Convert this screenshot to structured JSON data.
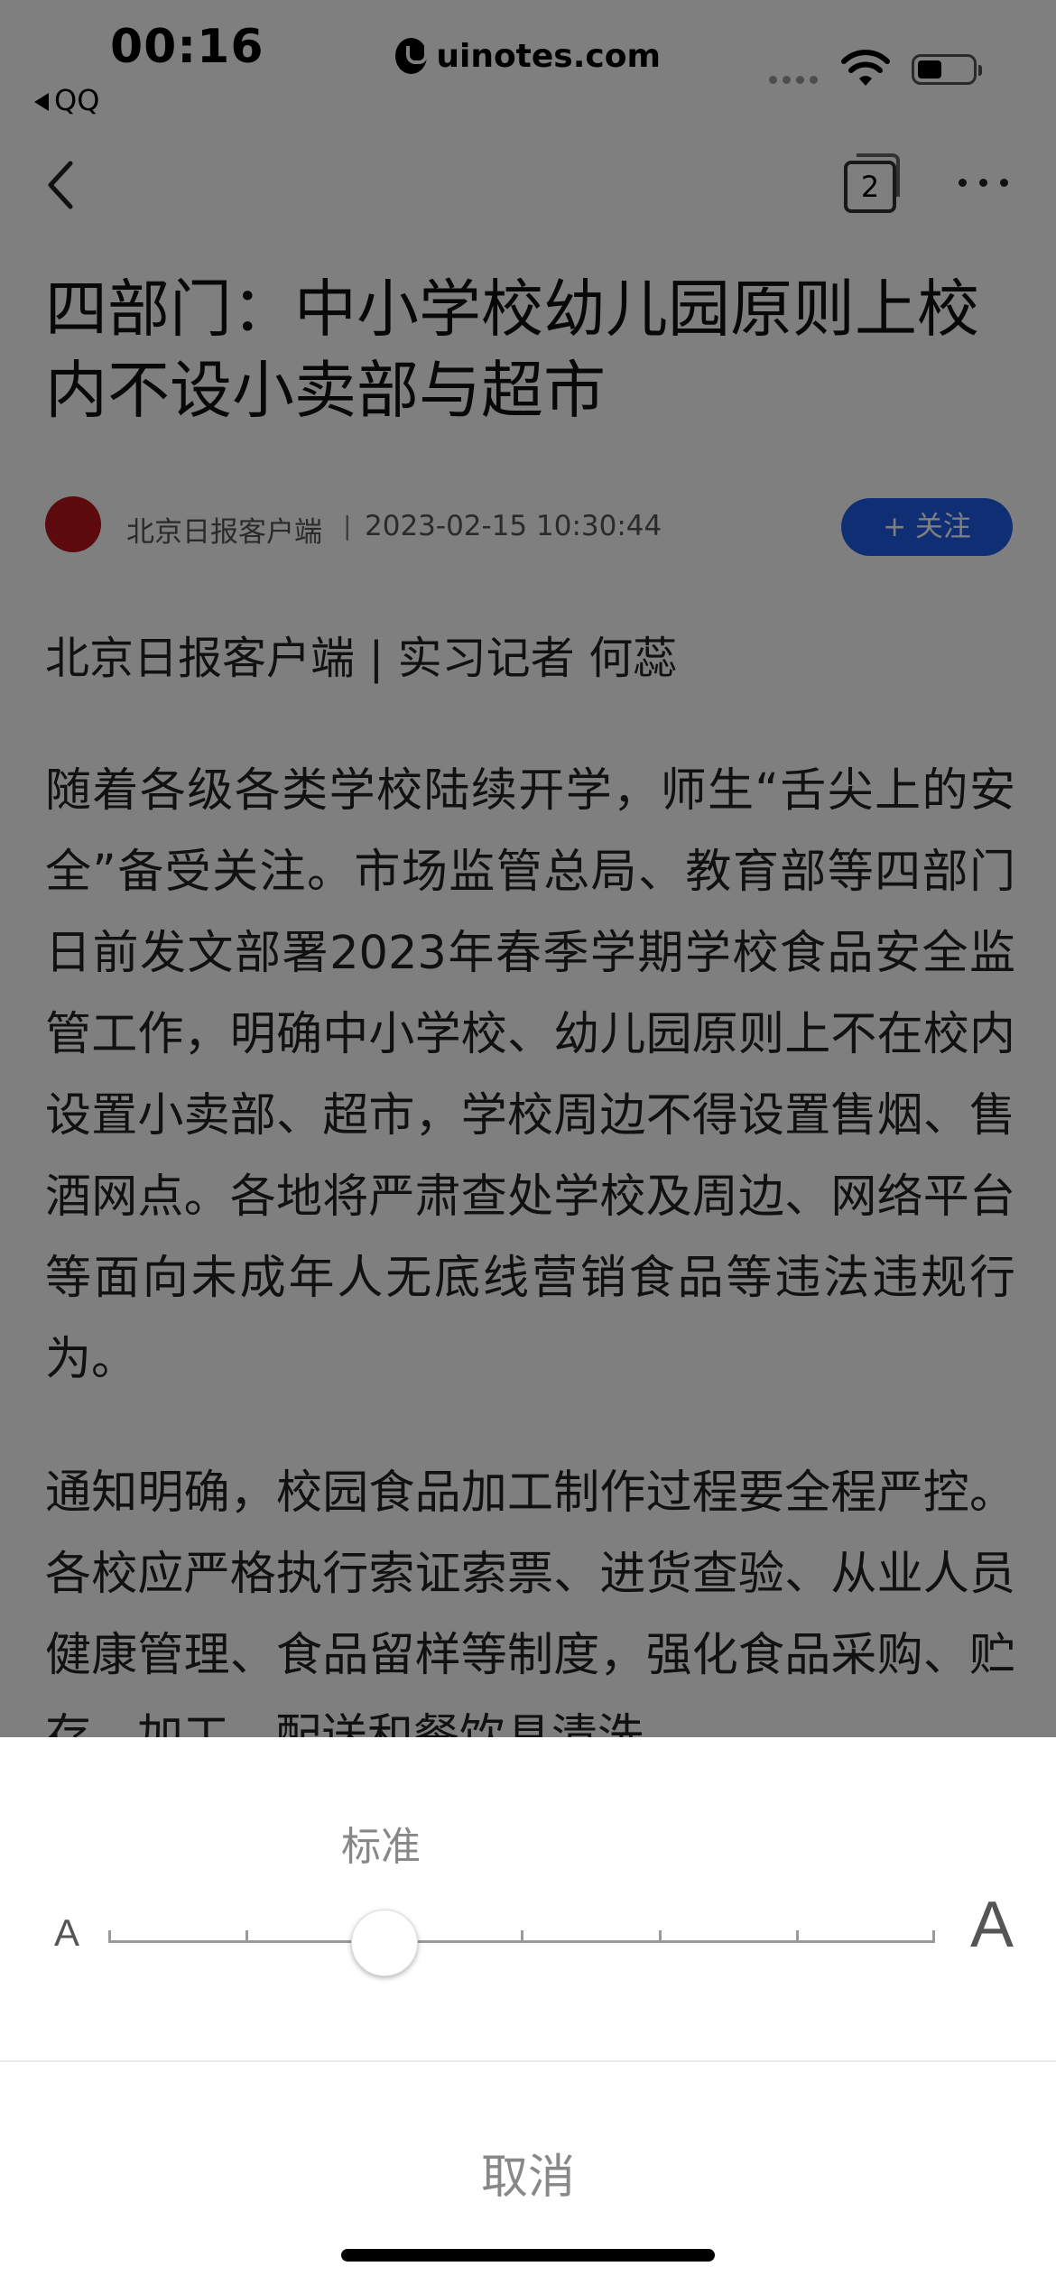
{
  "status_bar": {
    "time": "00:16",
    "back_app": "QQ",
    "watermark": "uinotes.com"
  },
  "nav": {
    "tab_count": "2"
  },
  "article": {
    "title": "四部门：中小学校幼儿园原则上校内不设小卖部与超市",
    "source": "北京日报客户端",
    "separator": "|",
    "datetime": "2023-02-15 10:30:44",
    "follow_label": "+ 关注",
    "byline": "北京日报客户端 | 实习记者 何蕊",
    "paragraphs": [
      "随着各级各类学校陆续开学，师生“舌尖上的安全”备受关注。市场监管总局、教育部等四部门日前发文部署2023年春季学期学校食品安全监管工作，明确中小学校、幼儿园原则上不在校内设置小卖部、超市，学校周边不得设置售烟、售酒网点。各地将严肃查处学校及周边、网络平台等面向未成年人无底线营销食品等违法违规行为。",
      "通知明确，校园食品加工制作过程要全程严控。各校应严格执行索证索票、进货查验、从业人员健康管理、食品留样等制度，强化食品采购、贮存、加工、配送和餐饮具清洗"
    ]
  },
  "font_sheet": {
    "current_size_label": "标准",
    "small_label": "A",
    "large_label": "A",
    "steps": 7,
    "selected_step": 3,
    "cancel_label": "取消"
  }
}
